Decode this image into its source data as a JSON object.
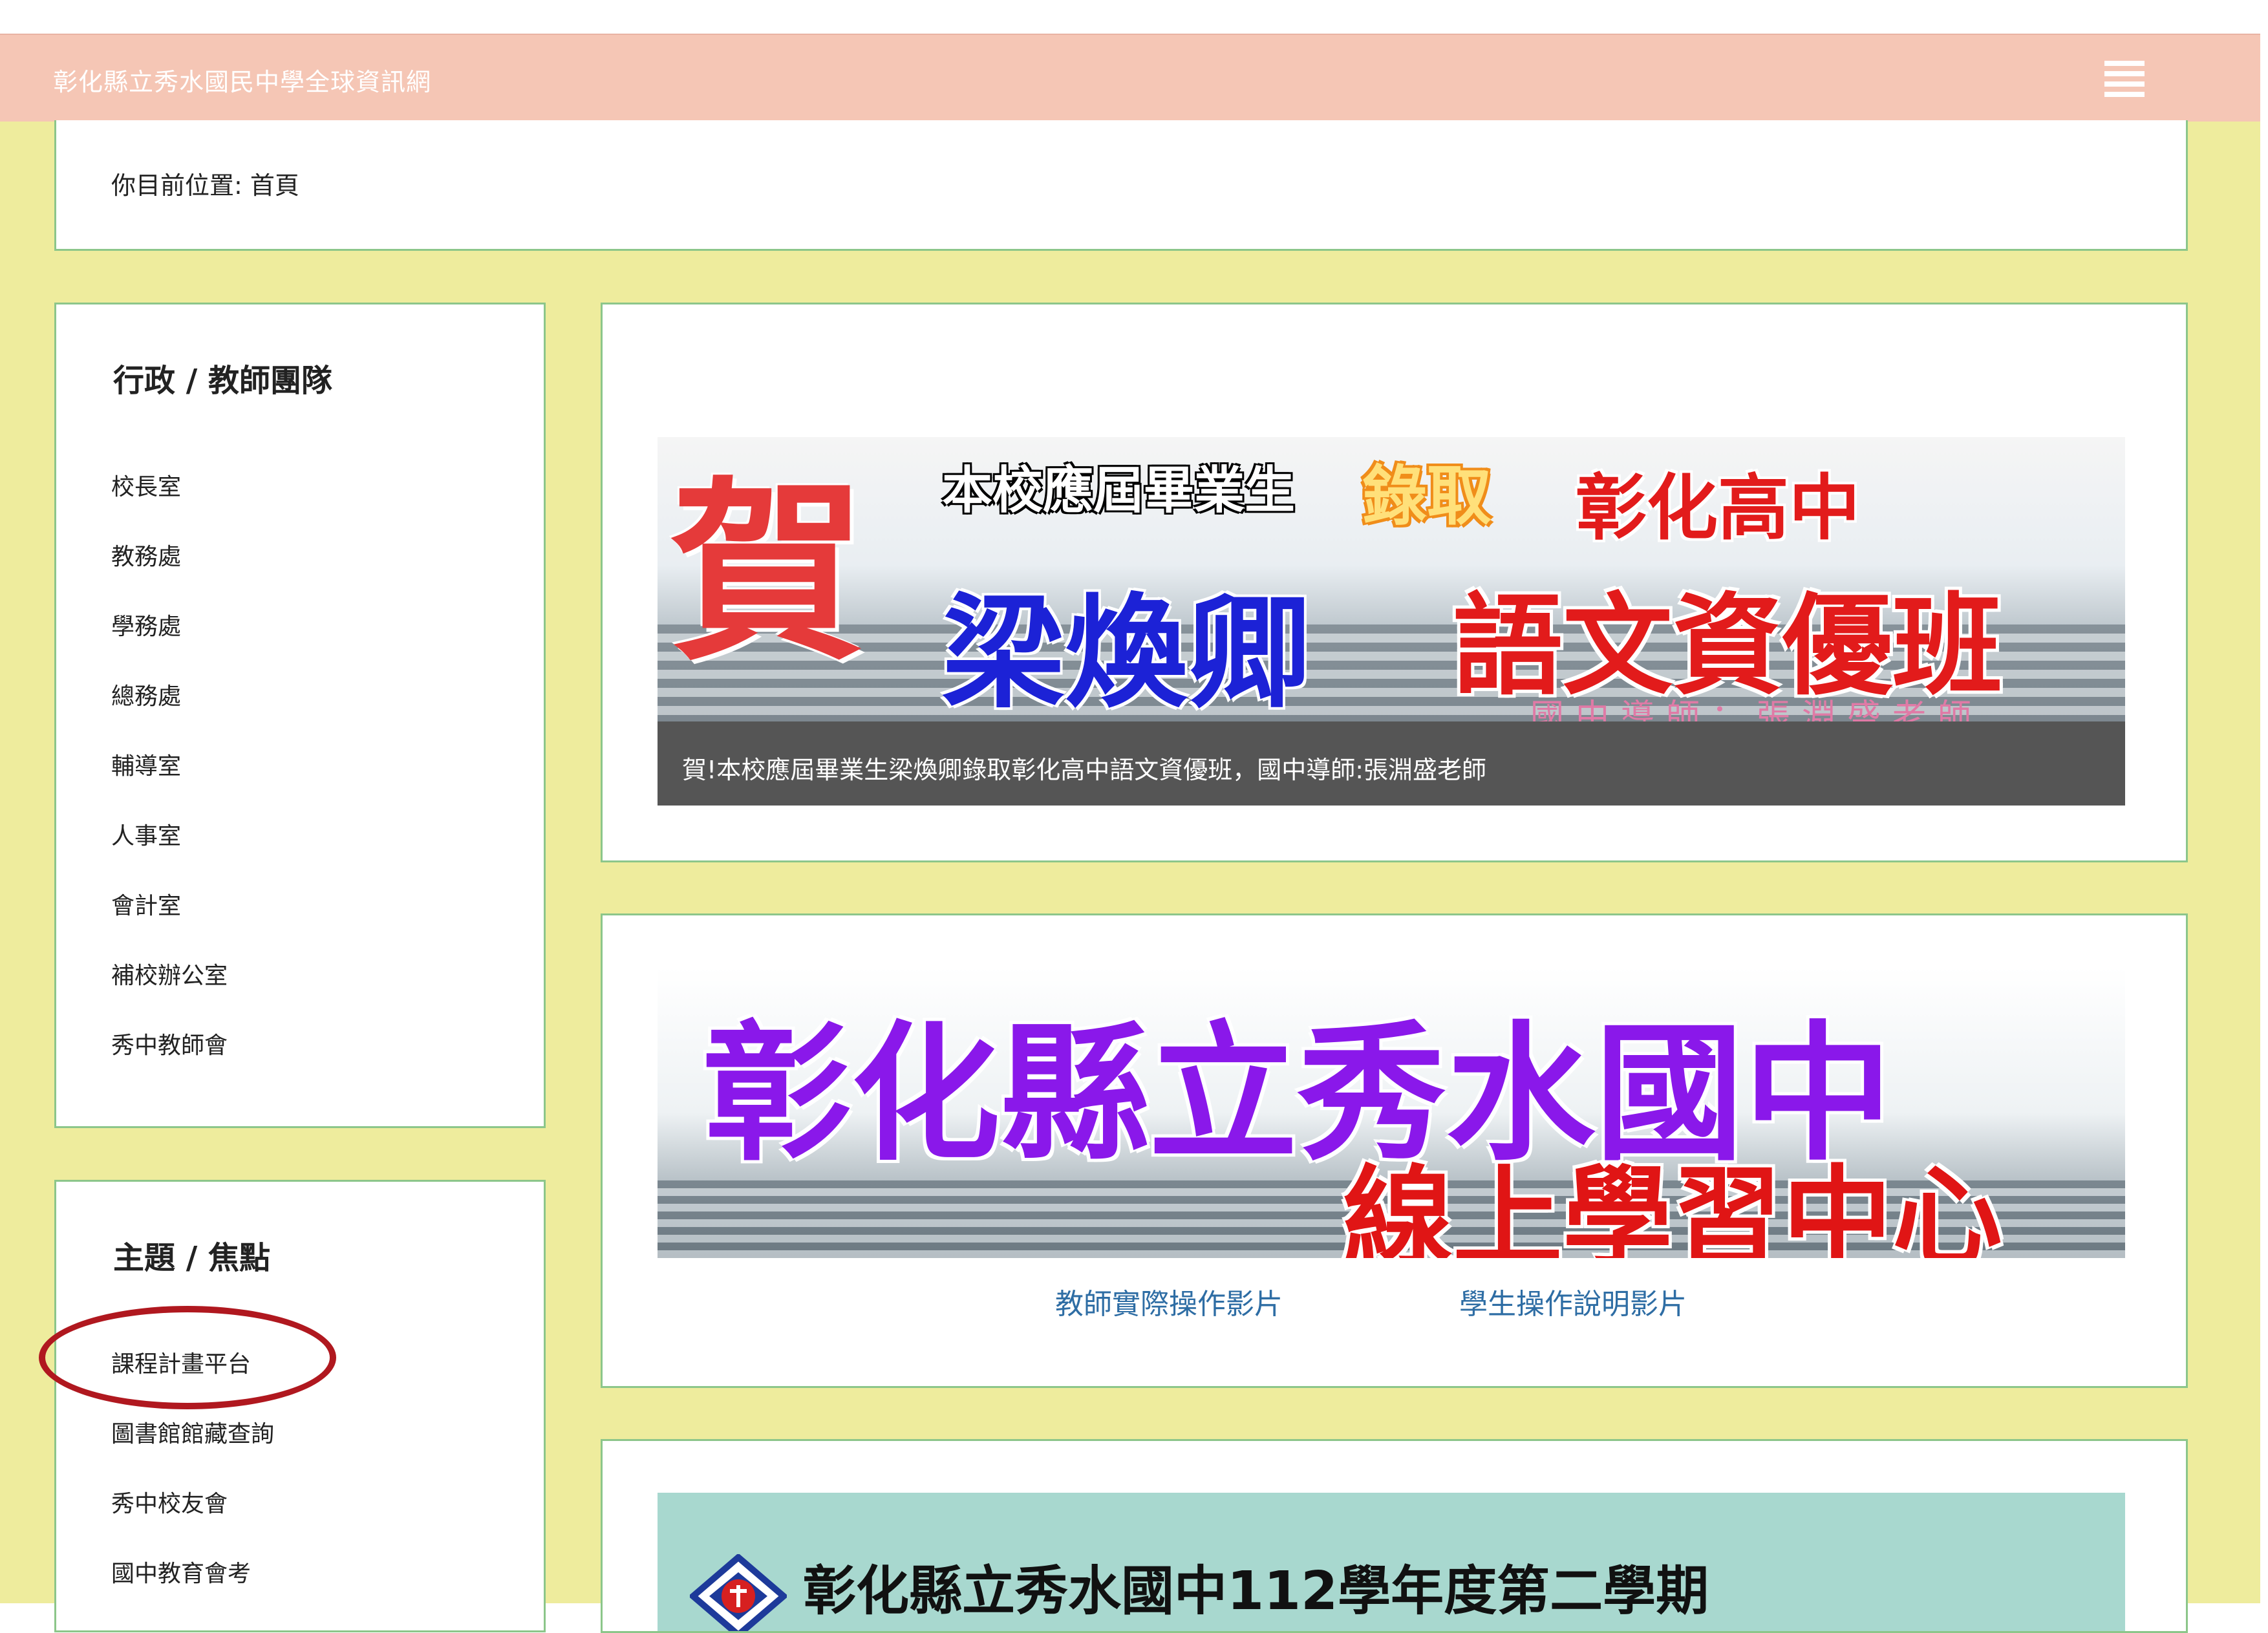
{
  "header": {
    "site_title": "彰化縣立秀水國民中學全球資訊網",
    "menu_icon": "hamburger-menu-icon"
  },
  "breadcrumb": {
    "text": "你目前位置:  首頁"
  },
  "sidebar": {
    "admin": {
      "title": "行政 / 教師團隊",
      "items": [
        "校長室",
        "教務處",
        "學務處",
        "總務處",
        "輔導室",
        "人事室",
        "會計室",
        "補校辦公室",
        "秀中教師會"
      ]
    },
    "topics": {
      "title": "主題 / 焦點",
      "items": [
        "課程計畫平台",
        "圖書館館藏查詢",
        "秀中校友會",
        "國中教育會考"
      ]
    }
  },
  "slides": {
    "slide1": {
      "banner": {
        "he": "賀",
        "line1": "本校應屆畢業生",
        "admit": "錄取",
        "school": "彰化高中",
        "name": "梁煥卿",
        "class": "語文資優班",
        "teacher": "國中導師：張淵盛老師"
      },
      "caption": "賀!本校應屆畢業生梁煥卿錄取彰化高中語文資優班，國中導師:張淵盛老師"
    },
    "slide2": {
      "banner": {
        "line1": "彰化縣立秀水國中",
        "line2": "線上學習中心"
      },
      "links": [
        "教師實際操作影片",
        "學生操作說明影片"
      ]
    },
    "slide3": {
      "banner_text": "彰化縣立秀水國中112學年度第二學期"
    }
  },
  "colors": {
    "navbar": "#f5c6b5",
    "background": "#eeec9d",
    "card_border": "#8cc68a",
    "link": "#2e6da4",
    "highlight_ring": "#b0181f"
  }
}
